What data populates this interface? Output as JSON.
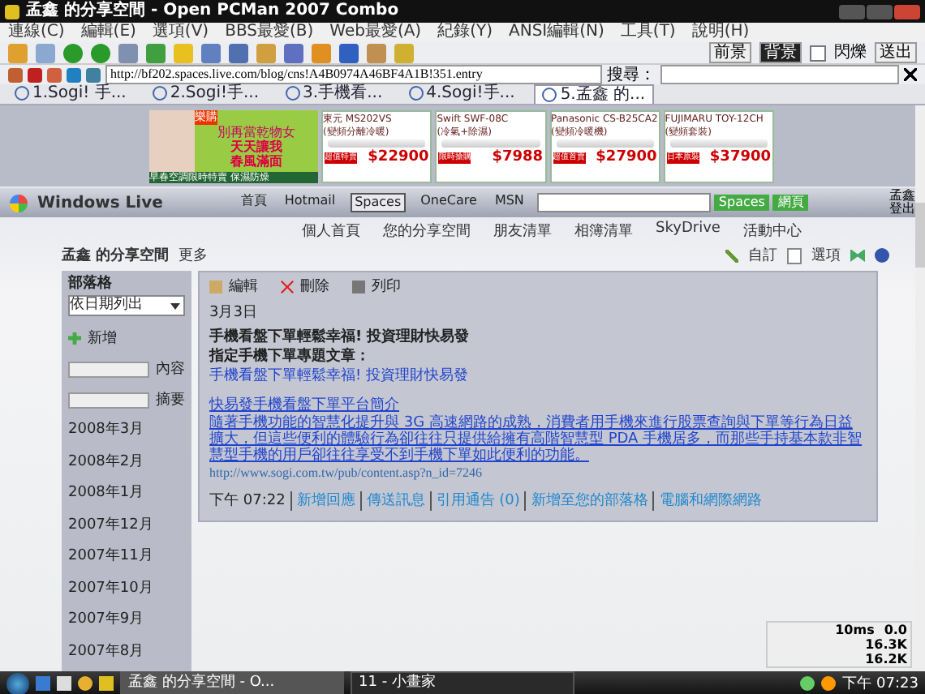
{
  "window": {
    "title": "孟鑫 的分享空間 - Open PCMan 2007 Combo"
  },
  "menu": [
    "連線(C)",
    "編輯(E)",
    "選項(V)",
    "BBS最愛(B)",
    "Web最愛(A)",
    "紀錄(Y)",
    "ANSI編輯(N)",
    "工具(T)",
    "說明(H)"
  ],
  "toolbar_right": {
    "buttons": [
      {
        "label": "前景",
        "selected": false
      },
      {
        "label": "背景",
        "selected": true
      }
    ],
    "blink": {
      "label": "閃爍",
      "checked": false
    },
    "send": "送出"
  },
  "address": {
    "url": "http://bf202.spaces.live.com/blog/cns!A4B0974A46BF4A1B!351.entry",
    "search_label": "搜尋："
  },
  "tabs": [
    {
      "label": "1.Sogi! 手...",
      "selected": false
    },
    {
      "label": "2.Sogi!手...",
      "selected": false
    },
    {
      "label": "3.手機看...",
      "selected": false
    },
    {
      "label": "4.Sogi!手...",
      "selected": false
    },
    {
      "label": "5.孟鑫 的...",
      "selected": true
    }
  ],
  "ad": {
    "badge": "樂購",
    "headline": "別再當乾物女",
    "slogan_1": "天天讓我",
    "slogan_2": "春風滿面",
    "footer": "早春空調限時特賣 保濕防燥",
    "products": [
      {
        "name": "東元 MS202VS",
        "desc": "(變頻分離冷暖)",
        "tag": "超值特賣",
        "price": "$22900"
      },
      {
        "name": "Swift SWF-08C",
        "desc": "(冷氣+除濕)",
        "tag": "限時搶購",
        "price": "$7988"
      },
      {
        "name": "Panasonic CS-B25CA2",
        "desc": "(變頻冷暖機)",
        "tag": "超值首賣",
        "price": "$27900"
      },
      {
        "name": "FUJIMARU TOY-12CH",
        "desc": "(變頻套裝)",
        "tag": "日本原裝",
        "price": "$37900"
      }
    ]
  },
  "live_bar": {
    "brand": "Windows Live",
    "nav": [
      {
        "label": "首頁",
        "selected": false
      },
      {
        "label": "Hotmail",
        "selected": false
      },
      {
        "label": "Spaces",
        "selected": true
      },
      {
        "label": "OneCare",
        "selected": false
      },
      {
        "label": "MSN",
        "selected": false
      }
    ],
    "buttons": [
      "Spaces",
      "網頁"
    ],
    "user": "孟鑫",
    "sign_out": "登出"
  },
  "sub_nav": [
    "個人首頁",
    "您的分享空間",
    "朋友清單",
    "相簿清單",
    "SkyDrive",
    "活動中心"
  ],
  "space_header": {
    "title": "孟鑫 的分享空間",
    "more": "更多",
    "customize": "自訂",
    "options": "選項"
  },
  "sidebar": {
    "title": "部落格",
    "sort": "依日期列出",
    "actions": [
      "新增",
      "內容",
      "摘要"
    ],
    "months": [
      "2008年3月",
      "2008年2月",
      "2008年1月",
      "2007年12月",
      "2007年11月",
      "2007年10月",
      "2007年9月",
      "2007年8月"
    ]
  },
  "post": {
    "actions": [
      "編輯",
      "刪除",
      "列印"
    ],
    "date": "3月3日",
    "title": "手機看盤下單輕鬆幸福! 投資理財快易發",
    "subtitle": "指定手機下單專題文章：",
    "link_1": "手機看盤下單輕鬆幸福! 投資理財快易發",
    "link_2": "快易發手機看盤下單平台簡介",
    "body": "隨著手機功能的智慧化提升與 3G 高速網路的成熟，消費者用手機來進行股票查詢與下單等行為日益擴大，但這些便利的體驗行為卻往往只提供給擁有高階智慧型 PDA 手機居多，而那些手持基本款非智慧型手機的用戶卻往往享受不到手機下單如此便利的功能。",
    "url": "http://www.sogi.com.tw/pub/content.asp?n_id=7246",
    "time": "下午 07:22",
    "footer_links": [
      "新增回應",
      "傳送訊息",
      "引用通告 (0)",
      "新增至您的部落格",
      "電腦和網際網路"
    ]
  },
  "meter": {
    "ping": "10ms",
    "value": "0.0",
    "down": "16.3K",
    "up": "16.2K"
  },
  "taskbar": {
    "tasks": [
      {
        "label": "孟鑫 的分享空間 - O...",
        "selected": true
      },
      {
        "label": "11 - 小畫家",
        "selected": false
      }
    ],
    "clock": "下午 07:23"
  }
}
